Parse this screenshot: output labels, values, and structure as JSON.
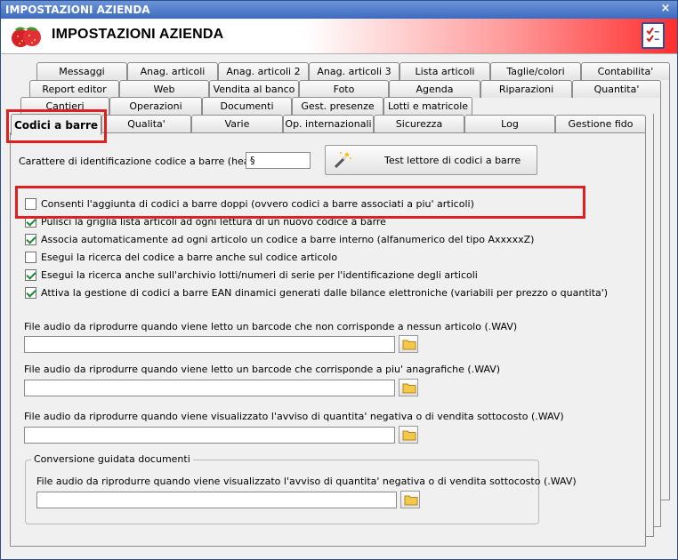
{
  "window": {
    "title": "IMPOSTAZIONI AZIENDA",
    "close_symbol": "×",
    "heading": "IMPOSTAZIONI AZIENDA",
    "logo_icon": "strawberry-logo-icon",
    "header_icon": "checklist-icon"
  },
  "tabs_row1": [
    "Messaggi",
    "Anag. articoli",
    "Anag. articoli 2",
    "Anag. articoli 3",
    "Lista articoli",
    "Taglie/colori",
    "Contabilita'"
  ],
  "tabs_row2": [
    "Report editor",
    "Web",
    "Vendita al banco",
    "Foto",
    "Agenda",
    "Riparazioni",
    "Quantita'"
  ],
  "tabs_row3": [
    "Cantieri",
    "Operazioni",
    "Documenti",
    "Gest. presenze",
    "Lotti e matricole"
  ],
  "tabs_row4": [
    "Codici a barre",
    "Qualita'",
    "Varie",
    "Op. internazionali",
    "Sicurezza",
    "Log",
    "Gestione fido"
  ],
  "barcode": {
    "header_char_label": "Carattere di identificazione codice a barre (header) :",
    "header_char_value": "§",
    "test_button_label": "Test lettore di codici a barre"
  },
  "options": [
    {
      "label": "Consenti l'aggiunta di codici a barre doppi (ovvero codici a barre associati a piu' articoli)",
      "checked": false
    },
    {
      "label": "Pulisci la griglia lista articoli ad ogni lettura di un nuovo codice a barre",
      "checked": true
    },
    {
      "label": "Associa automaticamente ad ogni articolo un codice a barre interno (alfanumerico del tipo AxxxxxZ)",
      "checked": true
    },
    {
      "label": "Esegui la ricerca del codice a barre anche sul codice articolo",
      "checked": false
    },
    {
      "label": "Esegui la ricerca anche sull'archivio lotti/numeri di serie per l'identificazione degli articoli",
      "checked": true
    },
    {
      "label": "Attiva la gestione di codici a barre EAN dinamici generati dalle bilance elettroniche (variabili per prezzo o quantita')",
      "checked": true
    }
  ],
  "audio": [
    {
      "label": "File audio da riprodurre quando viene letto un barcode che non corrisponde a nessun articolo (.WAV)",
      "value": ""
    },
    {
      "label": "File audio da riprodurre quando viene letto un barcode che corrisponde a piu' anagrafiche (.WAV)",
      "value": ""
    },
    {
      "label": "File audio da riprodurre quando viene visualizzato l'avviso di quantita' negativa o di vendita sottocosto (.WAV)",
      "value": ""
    }
  ],
  "conversion": {
    "group_title": "Conversione guidata documenti",
    "label": "File audio da riprodurre quando viene visualizzato l'avviso di quantita' negativa o di vendita sottocosto (.WAV)",
    "value": ""
  }
}
